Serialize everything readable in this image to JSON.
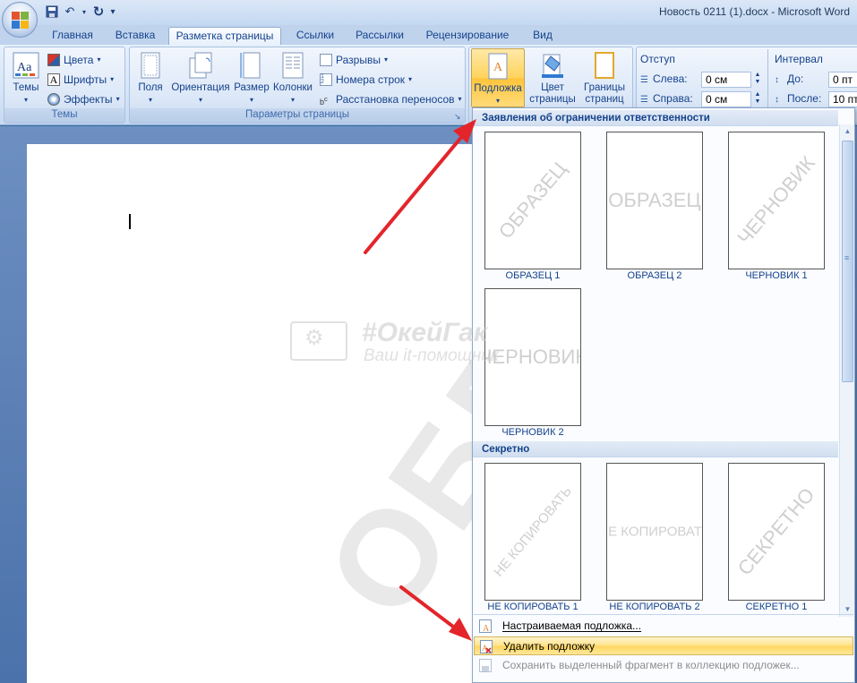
{
  "window": {
    "title": "Новость 0211 (1).docx - Microsoft Word"
  },
  "tabs": [
    "Главная",
    "Вставка",
    "Разметка страницы",
    "Ссылки",
    "Рассылки",
    "Рецензирование",
    "Вид"
  ],
  "active_tab": "Разметка страницы",
  "ribbon": {
    "themes": {
      "big_label": "Темы",
      "colors": "Цвета",
      "fonts": "Шрифты",
      "effects": "Эффекты",
      "group_label": "Темы"
    },
    "page_setup": {
      "margins": "Поля",
      "orientation": "Ориентация",
      "size": "Размер",
      "columns": "Колонки",
      "breaks": "Разрывы",
      "line_numbers": "Номера строк",
      "hyphenation": "Расстановка переносов",
      "group_label": "Параметры страницы"
    },
    "background": {
      "watermark_line1": "Подложка",
      "page_color_line1": "Цвет",
      "page_color_line2": "страницы",
      "page_borders_line1": "Границы",
      "page_borders_line2": "страниц"
    },
    "indent": {
      "label": "Отступ",
      "left_label": "Слева:",
      "left_value": "0 см",
      "right_label": "Справа:",
      "right_value": "0 см"
    },
    "spacing": {
      "label": "Интервал",
      "before_label": "До:",
      "before_value": "0 пт",
      "after_label": "После:",
      "after_value": "10 пт"
    }
  },
  "document": {
    "background_watermark_text": "ОБРАЗЕЦ"
  },
  "site_watermark": {
    "brand": "#ОкейГак",
    "tagline": "Ваш it-помощник"
  },
  "gallery": {
    "section1_title": "Заявления об ограничении ответственности",
    "section2_title": "Секретно",
    "section1_tiles": [
      {
        "caption": "ОБРАЗЕЦ 1",
        "watermark": "ОБРАЗЕЦ",
        "style": "diagonal"
      },
      {
        "caption": "ОБРАЗЕЦ 2",
        "watermark": "ОБРАЗЕЦ",
        "style": "horizontal"
      },
      {
        "caption": "ЧЕРНОВИК 1",
        "watermark": "ЧЕРНОВИК",
        "style": "diagonal"
      },
      {
        "caption": "ЧЕРНОВИК 2",
        "watermark": "ЧЕРНОВИК",
        "style": "horizontal"
      }
    ],
    "section2_tiles": [
      {
        "caption": "НЕ КОПИРОВАТЬ 1",
        "watermark": "НЕ КОПИРОВАТЬ",
        "style": "diagonal"
      },
      {
        "caption": "НЕ КОПИРОВАТЬ 2",
        "watermark": "НЕ КОПИРОВАТЬ",
        "style": "horizontal"
      },
      {
        "caption": "СЕКРЕТНО 1",
        "watermark": "СЕКРЕТНО",
        "style": "diagonal"
      }
    ],
    "menu": {
      "custom": "Настраиваемая подложка...",
      "remove": "Удалить подложку",
      "save": "Сохранить выделенный фрагмент в коллекцию подложек..."
    }
  },
  "colors": {
    "ribbon_text": "#15428b",
    "highlight": "#ffd35c",
    "arrow": "#e3252b"
  }
}
